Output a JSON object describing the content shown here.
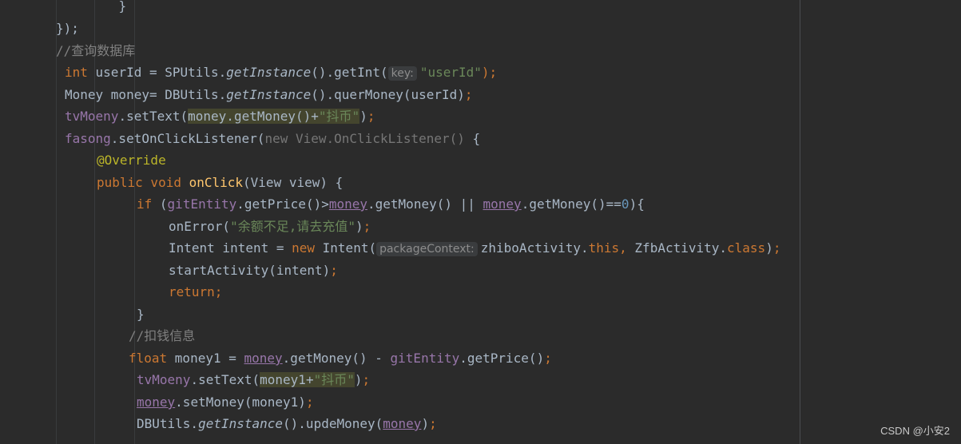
{
  "lines": [
    [
      {
        "t": "    }",
        "c": "plain"
      }
    ],
    [
      {
        "t": "});",
        "c": "plain"
      }
    ],
    [
      {
        "t": "//查询数据库",
        "c": "comment"
      }
    ],
    [
      {
        "t": "int",
        "c": "keyword"
      },
      {
        "t": " userId = SPUtils.",
        "c": "plain"
      },
      {
        "t": "getInstance",
        "c": "static"
      },
      {
        "t": "().getInt(",
        "c": "plain"
      },
      {
        "t": "key:",
        "c": "hint"
      },
      {
        "t": "\"userId\"",
        "c": "string"
      },
      {
        "t": ");",
        "c": "sep"
      }
    ],
    [
      {
        "t": "Money money= DBUtils.",
        "c": "plain"
      },
      {
        "t": "getInstance",
        "c": "static"
      },
      {
        "t": "().querMoney(userId)",
        "c": "plain"
      },
      {
        "t": ";",
        "c": "sep"
      }
    ],
    [
      {
        "t": "tvMoeny",
        "c": "field"
      },
      {
        "t": ".setText(",
        "c": "plain"
      },
      {
        "t": "money.getMoney()+",
        "c": "plain",
        "hl": true
      },
      {
        "t": "\"抖币\"",
        "c": "string",
        "hl": true
      },
      {
        "t": ")",
        "c": "plain"
      },
      {
        "t": ";",
        "c": "sep"
      }
    ],
    [
      {
        "t": "fasong",
        "c": "field"
      },
      {
        "t": ".setOnClickListener(",
        "c": "plain"
      },
      {
        "t": "new View.OnClickListener()",
        "c": "gray"
      },
      {
        "t": " {",
        "c": "plain"
      }
    ],
    [
      {
        "t": "@Override",
        "c": "annotation"
      }
    ],
    [
      {
        "t": "public void ",
        "c": "keyword"
      },
      {
        "t": "onClick",
        "c": "method"
      },
      {
        "t": "(View view) {",
        "c": "plain"
      }
    ],
    [
      {
        "t": "if ",
        "c": "keyword"
      },
      {
        "t": "(",
        "c": "plain"
      },
      {
        "t": "gitEntity",
        "c": "field"
      },
      {
        "t": ".getPrice()>",
        "c": "plain"
      },
      {
        "t": "money",
        "c": "field",
        "ul": true
      },
      {
        "t": ".getMoney() || ",
        "c": "plain"
      },
      {
        "t": "money",
        "c": "field",
        "ul": true
      },
      {
        "t": ".getMoney()==",
        "c": "plain"
      },
      {
        "t": "0",
        "c": "number"
      },
      {
        "t": "){",
        "c": "plain"
      }
    ],
    [
      {
        "t": "onError(",
        "c": "plain"
      },
      {
        "t": "\"余额不足,请去充值\"",
        "c": "string"
      },
      {
        "t": ")",
        "c": "plain"
      },
      {
        "t": ";",
        "c": "sep"
      }
    ],
    [
      {
        "t": "Intent intent = ",
        "c": "plain"
      },
      {
        "t": "new ",
        "c": "keyword"
      },
      {
        "t": "Intent(",
        "c": "plain"
      },
      {
        "t": "packageContext:",
        "c": "hint"
      },
      {
        "t": "zhiboActivity.",
        "c": "plain"
      },
      {
        "t": "this, ",
        "c": "keyword"
      },
      {
        "t": "ZfbActivity.",
        "c": "plain"
      },
      {
        "t": "class",
        "c": "keyword"
      },
      {
        "t": ")",
        "c": "plain"
      },
      {
        "t": ";",
        "c": "sep"
      }
    ],
    [
      {
        "t": "startActivity(intent)",
        "c": "plain"
      },
      {
        "t": ";",
        "c": "sep"
      }
    ],
    [
      {
        "t": "return;",
        "c": "keyword"
      }
    ],
    [
      {
        "t": "}",
        "c": "plain"
      }
    ],
    [
      {
        "t": "//扣钱信息",
        "c": "comment"
      }
    ],
    [
      {
        "t": "float ",
        "c": "keyword"
      },
      {
        "t": "money1 = ",
        "c": "plain"
      },
      {
        "t": "money",
        "c": "field",
        "ul": true
      },
      {
        "t": ".getMoney() - ",
        "c": "plain"
      },
      {
        "t": "gitEntity",
        "c": "field"
      },
      {
        "t": ".getPrice()",
        "c": "plain"
      },
      {
        "t": ";",
        "c": "sep"
      }
    ],
    [
      {
        "t": "tvMoeny",
        "c": "field"
      },
      {
        "t": ".setText(",
        "c": "plain"
      },
      {
        "t": "money1+",
        "c": "plain",
        "hl": true
      },
      {
        "t": "\"抖币\"",
        "c": "string",
        "hl": true
      },
      {
        "t": ")",
        "c": "plain"
      },
      {
        "t": ";",
        "c": "sep"
      }
    ],
    [
      {
        "t": "money",
        "c": "field",
        "ul": true
      },
      {
        "t": ".setMoney(money1)",
        "c": "plain"
      },
      {
        "t": ";",
        "c": "sep"
      }
    ],
    [
      {
        "t": "DBUtils.",
        "c": "plain"
      },
      {
        "t": "getInstance",
        "c": "static"
      },
      {
        "t": "().updeMoney(",
        "c": "plain"
      },
      {
        "t": "money",
        "c": "field",
        "ul": true
      },
      {
        "t": ")",
        "c": "plain"
      },
      {
        "t": ";",
        "c": "sep"
      }
    ]
  ],
  "watermark": "CSDN @小安2"
}
